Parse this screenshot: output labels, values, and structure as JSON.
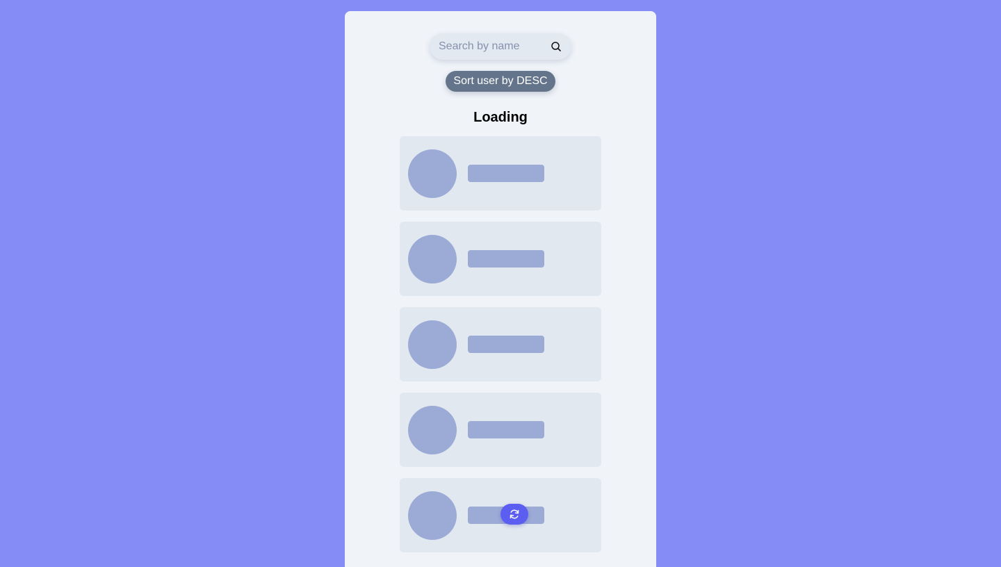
{
  "search": {
    "value": "",
    "placeholder": "Search by name",
    "icon": "search-icon"
  },
  "sort": {
    "label": "Sort user by DESC"
  },
  "status": {
    "title": "Loading"
  },
  "list": {
    "skeleton_cards": 5
  },
  "refresh": {
    "icon": "refresh-icon",
    "color": "#5b5ef0"
  },
  "colors": {
    "page_background": "#858cf6",
    "panel_background": "#f0f4f9",
    "card_background": "#e2e8f0",
    "skeleton": "#9cabd6",
    "sort_button": "#64748b"
  }
}
